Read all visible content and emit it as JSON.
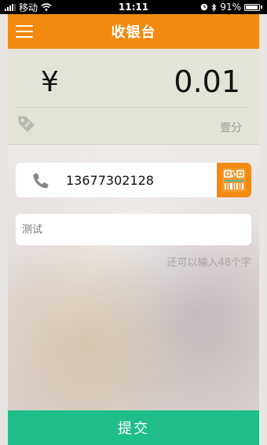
{
  "status_bar": {
    "carrier": "移动",
    "time": "11:11",
    "battery": "91%",
    "icons": [
      "signal-icon",
      "wifi-icon",
      "clock-icon",
      "bluetooth-icon",
      "battery-icon"
    ]
  },
  "nav": {
    "title": "收银台",
    "menu_icon": "menu-icon"
  },
  "amount": {
    "currency_symbol": "¥",
    "value": "0.01",
    "in_words": "壹分",
    "tag_icon": "tag-icon"
  },
  "phone": {
    "value": "13677302128",
    "icon": "phone-icon",
    "scan_icon": "qr-code-icon"
  },
  "note": {
    "placeholder": "测试",
    "char_hint": "还可以输入48个字"
  },
  "submit": {
    "label": "提交"
  },
  "colors": {
    "accent": "#f28a0f",
    "submit": "#1fbe8a",
    "amount_panel": "#e3e3d8"
  }
}
